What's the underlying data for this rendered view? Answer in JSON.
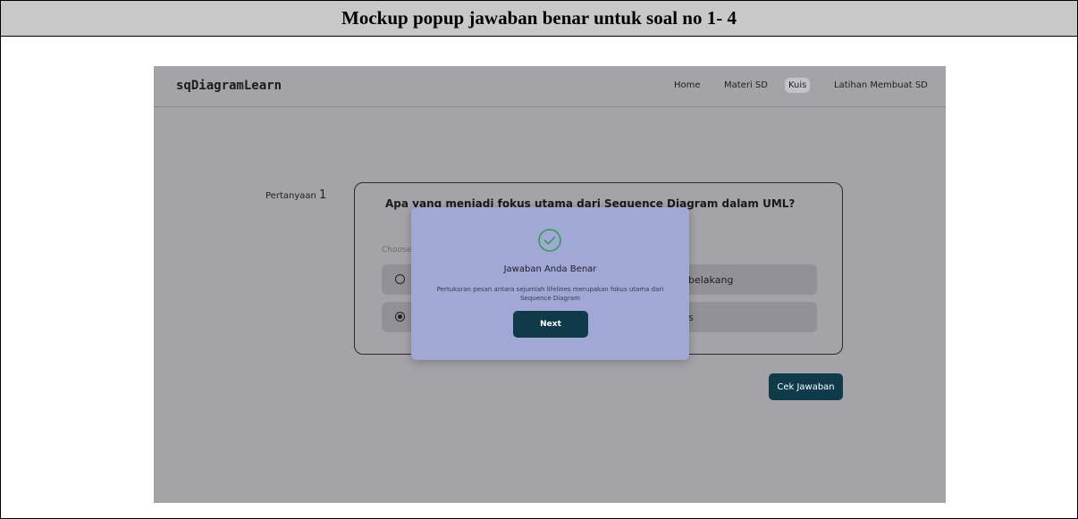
{
  "document": {
    "heading": "Mockup popup jawaban benar untuk soal no 1- 4"
  },
  "app": {
    "brand": "sqDiagramLearn",
    "nav": [
      {
        "label": "Home",
        "active": false
      },
      {
        "label": "Materi SD",
        "active": false
      },
      {
        "label": "Kuis",
        "active": true
      },
      {
        "label": "Latihan Membuat SD",
        "active": false
      }
    ]
  },
  "quiz": {
    "label_prefix": "Pertanyaan",
    "number": "1",
    "question": "Apa yang menjadi fokus utama dari Sequence Diagram dalam UML?",
    "choose_label": "Choose",
    "options": [
      {
        "visible_text": "belakang",
        "selected": false
      },
      {
        "visible_text": "s",
        "selected": true
      }
    ],
    "check_button": "Cek Jawaban"
  },
  "modal": {
    "icon": "check-circle-icon",
    "title": "Jawaban Anda Benar",
    "message": "Pertukaran pesan antara sejumlah lifelines merupakan fokus utama dari Sequence Diagram",
    "next_button": "Next"
  },
  "colors": {
    "primary_button": "#0f3a4a",
    "modal_bg": "#a1a8d6",
    "success_icon": "#2e9e4f",
    "overlay_bg": "#a4a3a8"
  }
}
